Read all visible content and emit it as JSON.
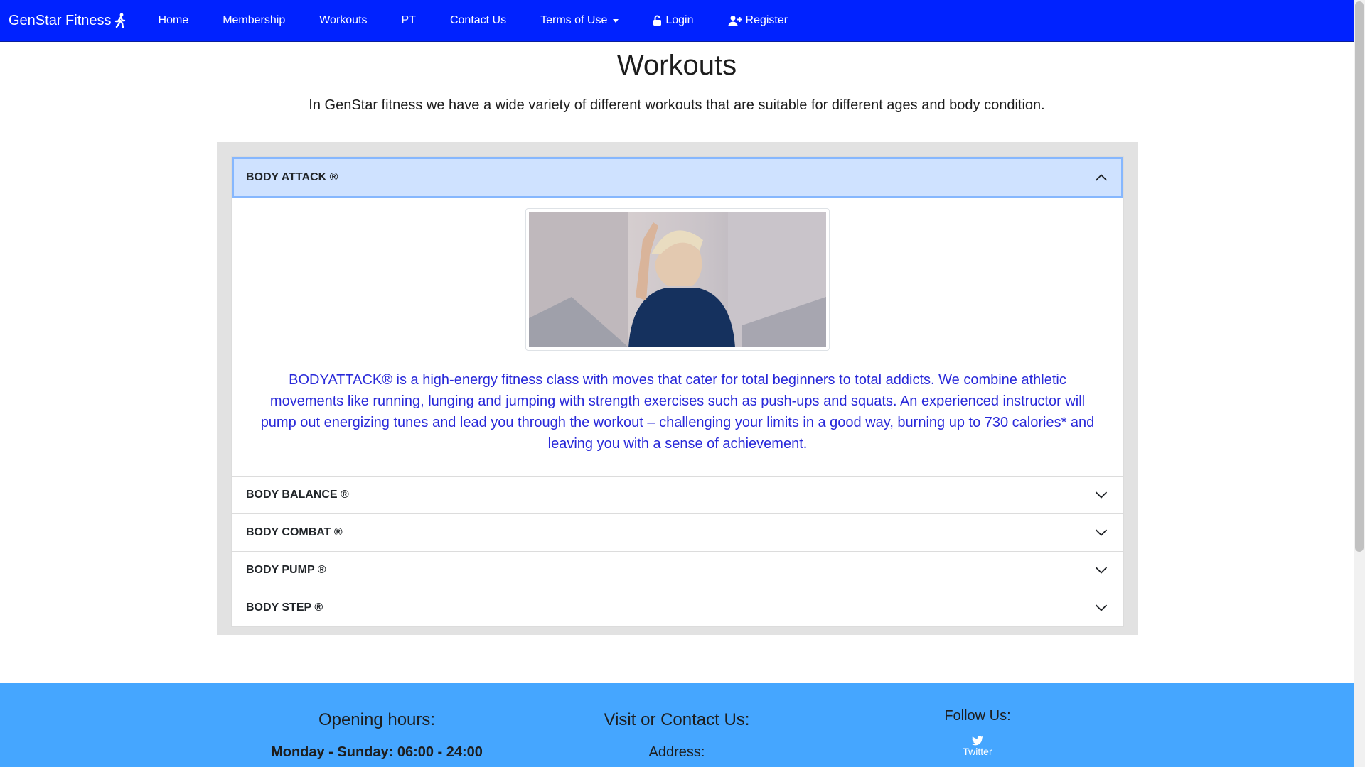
{
  "nav": {
    "brand": "GenStar Fitness",
    "items": [
      {
        "label": "Home"
      },
      {
        "label": "Membership"
      },
      {
        "label": "Workouts"
      },
      {
        "label": "PT"
      },
      {
        "label": "Contact Us"
      },
      {
        "label": "Terms of Use"
      },
      {
        "label": "Login"
      },
      {
        "label": "Register"
      }
    ]
  },
  "page": {
    "title": "Workouts",
    "intro": "In GenStar fitness we have a wide variety of different workouts that are suitable for different ages and body condition."
  },
  "accordion": {
    "items": [
      {
        "title": "BODY ATTACK ®",
        "expanded": true,
        "description": "BODYATTACK® is a high-energy fitness class with moves that cater for total beginners to total addicts. We combine athletic movements like running, lunging and jumping with strength exercises such as push-ups and squats. An experienced instructor will pump out energizing tunes and lead you through the workout – challenging your limits in a good way, burning up to 730 calories* and leaving you with a sense of achievement."
      },
      {
        "title": "BODY BALANCE ®",
        "expanded": false
      },
      {
        "title": "BODY COMBAT ®",
        "expanded": false
      },
      {
        "title": "BODY PUMP ®",
        "expanded": false
      },
      {
        "title": "BODY STEP ®",
        "expanded": false
      }
    ]
  },
  "footer": {
    "opening_heading": "Opening hours:",
    "opening_hours": "Monday - Sunday: 06:00 - 24:00",
    "contact_heading": "Visit or Contact Us:",
    "address_label": "Address:",
    "follow_heading": "Follow Us:",
    "twitter_label": "Twitter"
  },
  "colors": {
    "navbar": "#0022ff",
    "footer": "#45a6ff",
    "accent_text": "#2929d9",
    "active_header": "#cfe2ff"
  },
  "icons": {
    "brand": "running-person-icon",
    "login": "lock-icon",
    "register": "user-plus-icon",
    "expanded": "chevron-up-icon",
    "collapsed": "chevron-down-icon",
    "twitter": "twitter-icon"
  }
}
